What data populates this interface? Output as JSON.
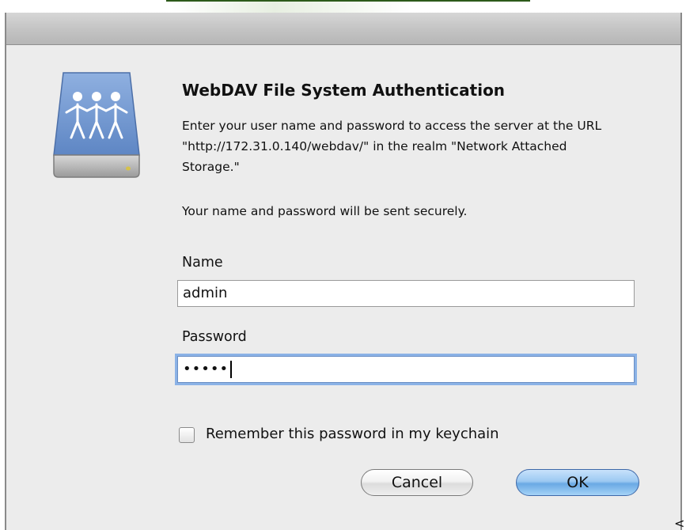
{
  "dialog": {
    "title": "WebDAV File System Authentication",
    "message": "Enter your user name and password to access the server at the URL \"http://172.31.0.140/webdav/\" in the realm \"Network Attached Storage.\"",
    "secure_note": "Your name and password will be sent securely.",
    "icon": "network-drive-icon"
  },
  "form": {
    "name_label": "Name",
    "name_value": "admin",
    "password_label": "Password",
    "password_value": "•••••",
    "remember_label": "Remember this password in my keychain",
    "remember_checked": false
  },
  "buttons": {
    "cancel_label": "Cancel",
    "ok_label": "OK"
  },
  "colors": {
    "dialog_bg": "#ececec",
    "focus_ring": "#8bb2e6",
    "default_button": "#6aa9e4"
  }
}
